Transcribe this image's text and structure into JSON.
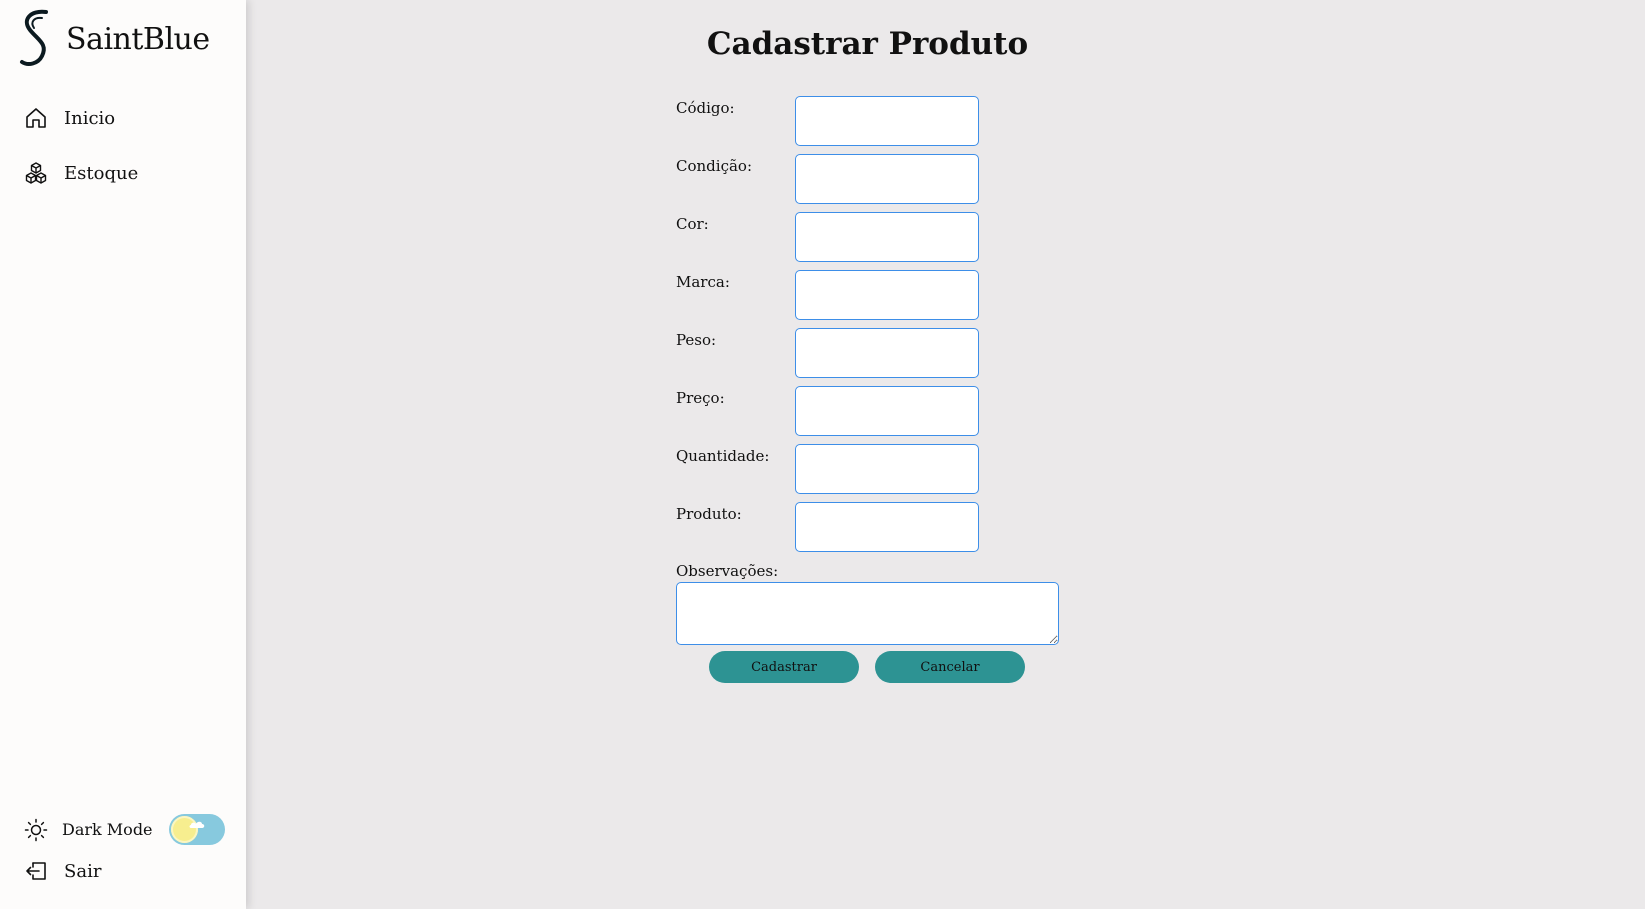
{
  "brand": {
    "name": "SaintBlue"
  },
  "nav": [
    {
      "label": "Inicio",
      "icon": "home-icon"
    },
    {
      "label": "Estoque",
      "icon": "cubes-icon"
    }
  ],
  "footer": {
    "dark_mode_label": "Dark Mode",
    "dark_mode_on": false,
    "logout_label": "Sair"
  },
  "form": {
    "title": "Cadastrar Produto",
    "fields": [
      {
        "label": "Código:",
        "value": ""
      },
      {
        "label": "Condição:",
        "value": ""
      },
      {
        "label": "Cor:",
        "value": ""
      },
      {
        "label": "Marca:",
        "value": ""
      },
      {
        "label": "Peso:",
        "value": ""
      },
      {
        "label": "Preço:",
        "value": ""
      },
      {
        "label": "Quantidade:",
        "value": ""
      },
      {
        "label": "Produto:",
        "value": ""
      }
    ],
    "observations_label": "Observações:",
    "observations_value": "",
    "submit_label": "Cadastrar",
    "cancel_label": "Cancelar"
  },
  "colors": {
    "accent": "#2d9393",
    "input_border": "#3d8ee8",
    "background": "#ebe9ea",
    "sidebar": "#fdfcfb"
  }
}
